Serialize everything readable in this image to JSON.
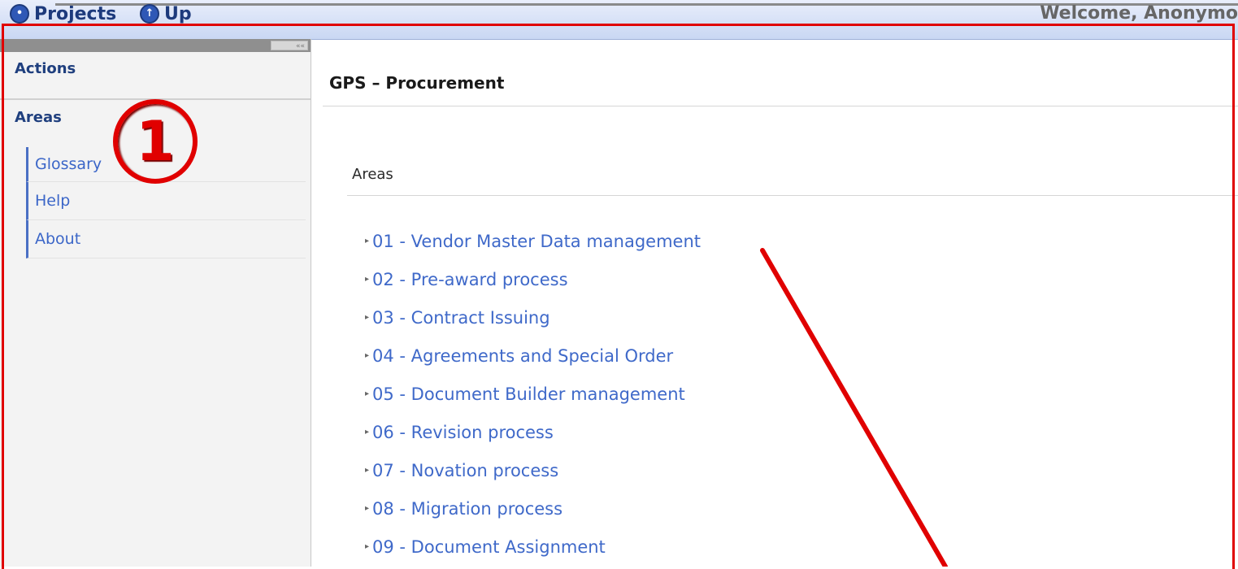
{
  "topbar": {
    "projects_label": "Projects",
    "up_label": "Up",
    "welcome_text": "Welcome, Anonymo"
  },
  "sidebar": {
    "actions_label": "Actions",
    "areas_label": "Areas",
    "links": [
      "Glossary",
      "Help",
      "About"
    ]
  },
  "main": {
    "title": "GPS – Procurement",
    "areas_title": "Areas",
    "areas": [
      "01 - Vendor Master Data management",
      "02 - Pre-award process",
      "03 - Contract Issuing",
      "04 - Agreements and Special Order",
      "05 - Document Builder management",
      "06 - Revision process",
      "07 - Novation process",
      "08 - Migration process",
      "09 - Document Assignment"
    ]
  },
  "annotation": {
    "badge_text": "1",
    "color": "#e00000"
  }
}
